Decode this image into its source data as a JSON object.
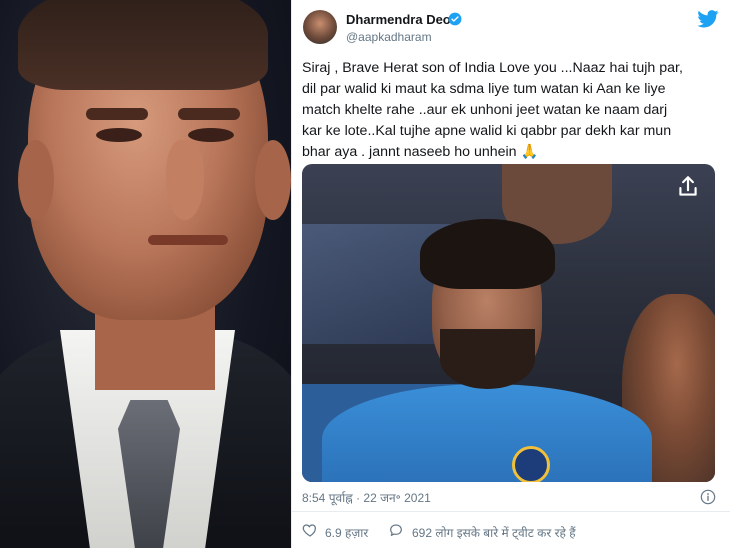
{
  "tweet": {
    "display_name": "Dharmendra Deol",
    "handle": "@aapkadharam",
    "text": "Siraj , Brave Herat son of India Love you ...Naaz hai tujh par,\ndil par walid ki maut ka sdma liye tum watan ki Aan ke liye\nmatch khelte rahe ..aur  ek unhoni jeet watan ke naam darj\nkar ke lote..Kal tujhe apne walid ki qabbr par dekh kar mun\nbhar aya . jannt naseeb ho unhein 🙏",
    "timestamp": "8:54 पूर्वाह्न · 22 जन॰ 2021",
    "like_count": "6.9 हज़ार",
    "reply_text": "692 लोग इसके बारे में ट्वीट कर रहे हैं"
  },
  "icons": {
    "verified": "verified-icon",
    "bird": "twitter-bird-icon",
    "share": "share-icon",
    "info": "info-icon",
    "like": "heart-icon",
    "reply": "comment-icon"
  },
  "colors": {
    "brand": "#1da1f2",
    "text": "#14171a",
    "secondary": "#657786"
  }
}
